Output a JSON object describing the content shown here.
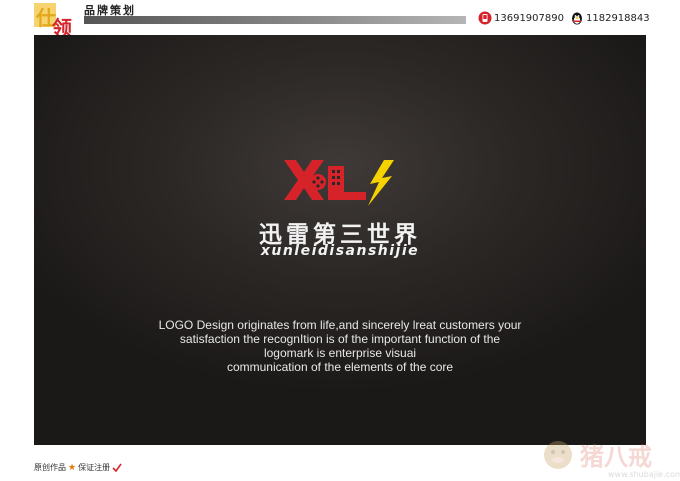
{
  "header": {
    "brand_text": "品牌策划",
    "phone_1": "13691907890",
    "phone_2": "1182918843"
  },
  "logo": {
    "mark_text": "XL",
    "chinese_name": "迅雷第三世界",
    "pinyin_name": "xunleidisanshijie"
  },
  "description": {
    "lines": [
      "LOGO Design originates from life,and sincerely lreat customers your",
      "satisfaction the recognItion is of the important function of the",
      "logomark is enterprise visuai",
      "communication of the elements of the core"
    ]
  },
  "footer": {
    "left_text_1": "原创作品",
    "left_text_2": "保证注册"
  },
  "colors": {
    "brand_red": "#d6232a",
    "bolt_yellow": "#f5d200",
    "panel_dark": "#2b2725"
  }
}
